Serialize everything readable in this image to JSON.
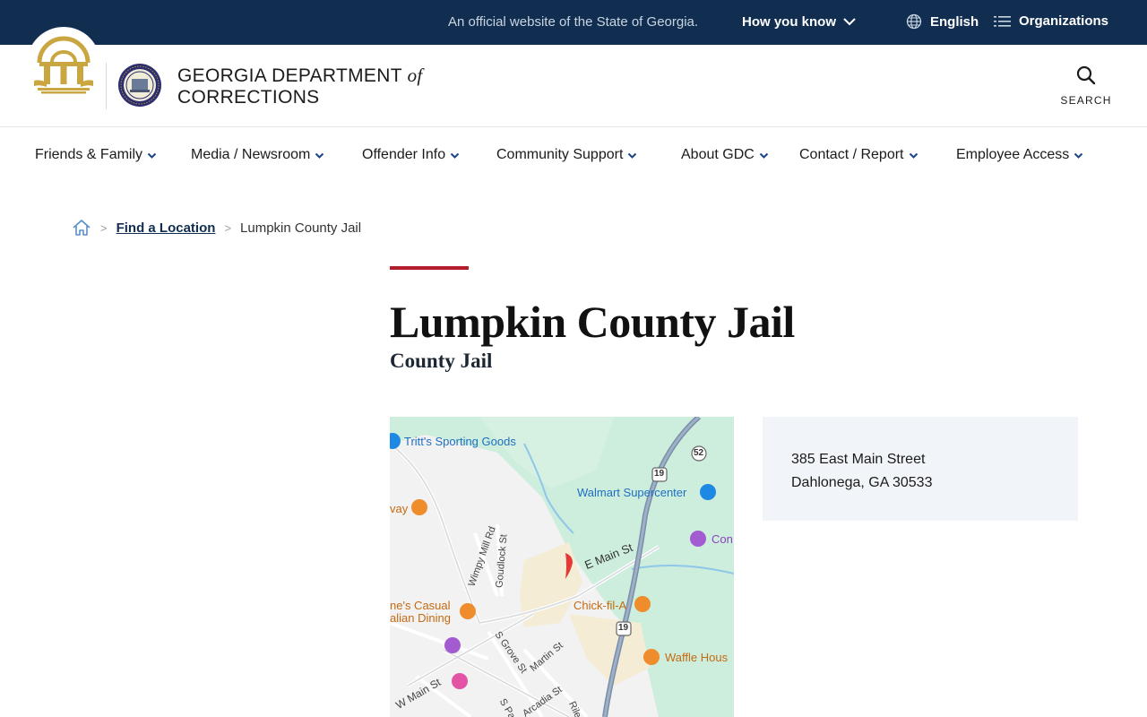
{
  "topbar": {
    "official_text": "An official website of the State of Georgia.",
    "how_you_know": "How you know",
    "language": "English",
    "organizations": "Organizations"
  },
  "header": {
    "agency_line1": "GEORGIA DEPARTMENT",
    "agency_of": "of",
    "agency_line2": "CORRECTIONS",
    "search_label": "SEARCH"
  },
  "nav": {
    "items": [
      {
        "label": "Friends & Family"
      },
      {
        "label": "Media / Newsroom"
      },
      {
        "label": "Offender Info"
      },
      {
        "label": "Community Support"
      },
      {
        "label": "About GDC"
      },
      {
        "label": "Contact / Report"
      },
      {
        "label": "Employee Access"
      }
    ]
  },
  "breadcrumb": {
    "link": "Find a Location",
    "current": "Lumpkin County Jail"
  },
  "page": {
    "title": "Lumpkin County Jail",
    "subtitle": "County Jail"
  },
  "map": {
    "labels": {
      "tritts": "Tritt's Sporting Goods",
      "walmart": "Walmart Supercenter",
      "conn": "Con",
      "way": "vay",
      "emain": "E Main St",
      "chickfila": "Chick-fil-A",
      "waffle": "Waffle Hous",
      "casual1": "ne's Casual",
      "casual2": "alian Dining",
      "wimpy": "Wimpy Mill Rd",
      "goudlock": "Goudlock St",
      "sgrove": "S Grove St",
      "martin": "Martin St",
      "wmain": "W Main St",
      "arcadia": "Arcadia St",
      "sp": "S Pa",
      "rile": "Rile",
      "route19a": "19",
      "route19b": "19",
      "route52": "52"
    }
  },
  "address": {
    "line1": "385 East Main Street",
    "line2": "Dahlonega, GA 30533"
  },
  "colors": {
    "topbar_bg": "#112e51",
    "accent_red": "#b51d2a",
    "nav_chevron": "#1a4480",
    "address_bg": "#f1f4f8"
  }
}
